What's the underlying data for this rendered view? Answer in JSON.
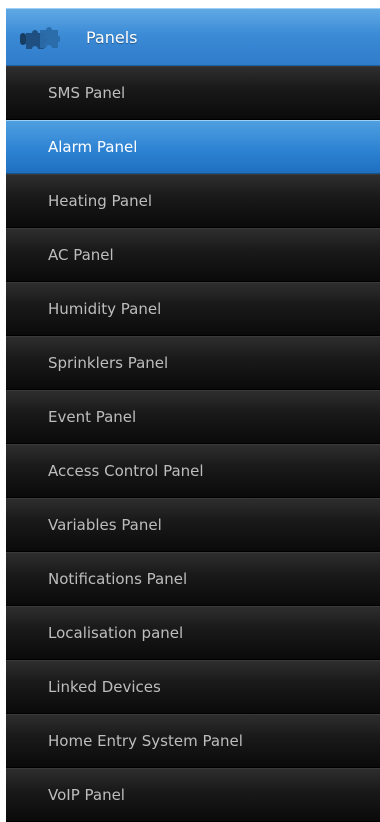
{
  "header": {
    "title": "Panels",
    "icon": "puzzle-icon",
    "color": "#3c8bd6"
  },
  "menu": {
    "active_index": 1,
    "active_color": "#2e83d3",
    "items": [
      {
        "label": "SMS Panel"
      },
      {
        "label": "Alarm Panel"
      },
      {
        "label": "Heating Panel"
      },
      {
        "label": "AC Panel"
      },
      {
        "label": "Humidity Panel"
      },
      {
        "label": "Sprinklers Panel"
      },
      {
        "label": "Event Panel"
      },
      {
        "label": "Access Control Panel"
      },
      {
        "label": "Variables Panel"
      },
      {
        "label": "Notifications Panel"
      },
      {
        "label": "Localisation panel"
      },
      {
        "label": "Linked Devices"
      },
      {
        "label": "Home Entry System Panel"
      },
      {
        "label": "VoIP Panel"
      }
    ]
  }
}
